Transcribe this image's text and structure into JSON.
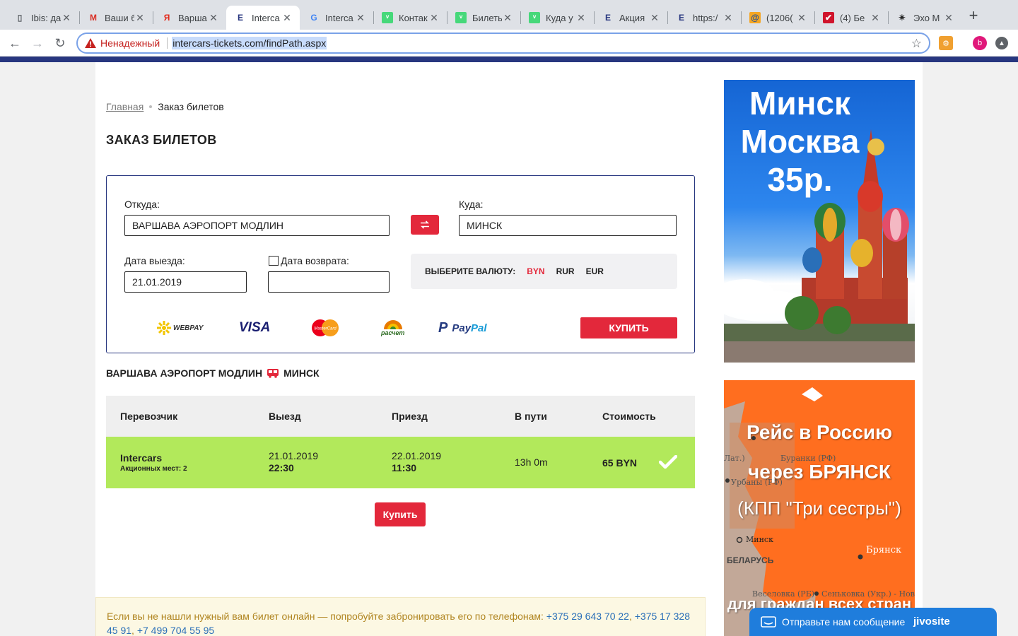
{
  "browser": {
    "tabs": [
      {
        "title": "Ibis: да",
        "icon": "page-icon"
      },
      {
        "title": "Ваши б",
        "icon": "gmail-icon"
      },
      {
        "title": "Варша",
        "icon": "yandex-icon"
      },
      {
        "title": "Interca",
        "icon": "intercars-icon"
      },
      {
        "title": "Interca",
        "icon": "google-icon"
      },
      {
        "title": "Контак",
        "icon": "tourist-icon"
      },
      {
        "title": "Билеть",
        "icon": "tourist-icon"
      },
      {
        "title": "Куда у",
        "icon": "tourist-icon"
      },
      {
        "title": "Акция",
        "icon": "intercars-icon"
      },
      {
        "title": "https:/",
        "icon": "intercars-icon"
      },
      {
        "title": "(1206(",
        "icon": "mail-at-icon"
      },
      {
        "title": "(4) Бе",
        "icon": "shield-red-icon"
      },
      {
        "title": "Эхо М",
        "icon": "echo-icon"
      }
    ],
    "active_tab_index": 3,
    "security_label": "Ненадежный",
    "url": "intercars-tickets.com/findPath.aspx",
    "profile_letter": "b"
  },
  "breadcrumb": {
    "home": "Главная",
    "current": "Заказ билетов"
  },
  "page_title": "ЗАКАЗ БИЛЕТОВ",
  "form": {
    "from_label": "Откуда:",
    "from_value": "ВАРШАВА АЭРОПОРТ МОДЛИН",
    "to_label": "Куда:",
    "to_value": "МИНСК",
    "departure_label": "Дата выезда:",
    "departure_value": "21.01.2019",
    "return_label": "Дата возврата:",
    "return_value": "",
    "currency_label": "ВЫБЕРИТЕ ВАЛЮТУ:",
    "currencies": [
      "BYN",
      "RUR",
      "EUR"
    ],
    "selected_currency": "BYN",
    "buy_label": "КУПИТЬ"
  },
  "payment_logos": {
    "webpay": "WEBPAY",
    "visa": "VISA",
    "mastercard": "MasterCard",
    "raschet": "расчет",
    "paypal_pay": "Pay",
    "paypal_pal": "Pal"
  },
  "route": {
    "from": "ВАРШАВА АЭРОПОРТ МОДЛИН",
    "to": "МИНСК"
  },
  "table": {
    "headers": [
      "Перевозчик",
      "Выезд",
      "Приезд",
      "В пути",
      "Стоимость"
    ],
    "row": {
      "carrier": "Intercars",
      "promo_seats": "Акционных мест: 2",
      "depart_date": "21.01.2019",
      "depart_time": "22:30",
      "arrive_date": "22.01.2019",
      "arrive_time": "11:30",
      "duration": "13h 0m",
      "price": "65 BYN"
    }
  },
  "buy_button": "Купить",
  "notice": {
    "text": "Если вы не нашли нужный вам билет онлайн — попробуйте забронировать его по телефонам: ",
    "phone1": "+375 29 643 70 22",
    "phone2": "+375 17 328 45 91",
    "phone3": "+7 499 704 55 95"
  },
  "ads": {
    "ad1_line1": "Минск",
    "ad1_line2": "Москва",
    "ad1_line3": "35р.",
    "ad2_line1": "Рейс в Россию",
    "ad2_line2": "через БРЯНСК",
    "ad2_line3": "(КПП \"Три сестры\")",
    "ad2_line4": "для граждан всех стран",
    "map_labels": [
      "Лат.)",
      "Буранки (РФ)",
      "Урбаны (РФ)",
      "Минск",
      "Брянск",
      "БЕЛАРУСЬ",
      "Веселовка (РБ)",
      "Сеньковка (Укр.) - Нов"
    ]
  },
  "jivo": {
    "message": "Отправьте нам сообщение",
    "brand": "jivosite"
  }
}
